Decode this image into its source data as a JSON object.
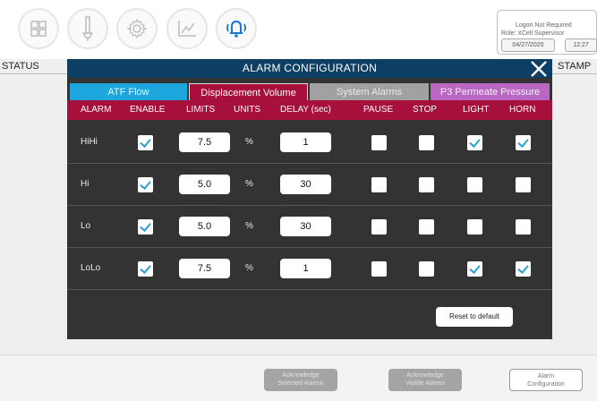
{
  "top_nav": {
    "icons": [
      "dashboard-grid-icon",
      "probe-icon",
      "gear-icon",
      "trend-chart-icon",
      "alarm-bell-icon"
    ]
  },
  "logon": {
    "status": "Logon Not Required",
    "role": "Role: XCell Supervisor",
    "date": "04/27/2020",
    "time": "12:27"
  },
  "background_labels": {
    "status": "STATUS",
    "stamp": "STAMP"
  },
  "dialog": {
    "title": "ALARM  CONFIGURATION",
    "tabs": [
      {
        "label": "ATF Flow",
        "color": "#1ea6df"
      },
      {
        "label": "Displacement Volume",
        "color": "#a6103a"
      },
      {
        "label": "System Alarms",
        "color": "#a1a1a1"
      },
      {
        "label": "P3 Permeate Pressure",
        "color": "#b868c2"
      }
    ],
    "headers": [
      "ALARM",
      "ENABLE",
      "LIMITS",
      "UNITS",
      "DELAY (sec)",
      "PAUSE",
      "STOP",
      "LIGHT",
      "HORN"
    ],
    "rows": [
      {
        "alarm": "HiHi",
        "enable": true,
        "limit": "7.5",
        "units": "%",
        "delay": "1",
        "pause": false,
        "stop": false,
        "light": true,
        "horn": true
      },
      {
        "alarm": "Hi",
        "enable": true,
        "limit": "5.0",
        "units": "%",
        "delay": "30",
        "pause": false,
        "stop": false,
        "light": false,
        "horn": false
      },
      {
        "alarm": "Lo",
        "enable": true,
        "limit": "5.0",
        "units": "%",
        "delay": "30",
        "pause": false,
        "stop": false,
        "light": false,
        "horn": false
      },
      {
        "alarm": "LoLo",
        "enable": true,
        "limit": "7.5",
        "units": "%",
        "delay": "1",
        "pause": false,
        "stop": false,
        "light": true,
        "horn": true
      }
    ],
    "reset_label": "Reset to default"
  },
  "footer": {
    "ack_selected": [
      "Acknowledge",
      "Selected Alarms"
    ],
    "ack_visible": [
      "Acknowledge",
      "Visible Alarms"
    ],
    "alarm_config": [
      "Alarm",
      "Configuration"
    ]
  },
  "colors": {
    "title_bar": "#0d3e63",
    "header_bar": "#a6103a",
    "dialog_body": "#333333",
    "check_accent": "#2a9fd6",
    "alarm_bell_accent": "#1877d4"
  }
}
